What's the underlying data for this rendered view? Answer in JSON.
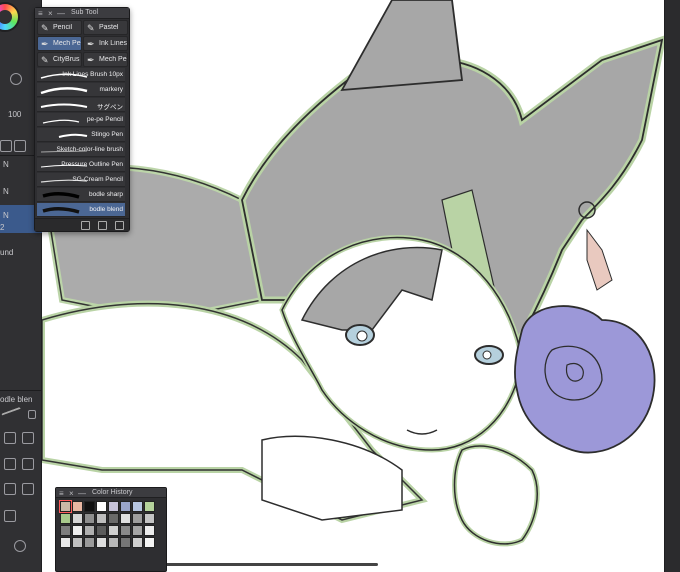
{
  "left_rail": {
    "zoom_value": "100",
    "layer_labels": [
      "N",
      "N",
      "N",
      "2"
    ],
    "layer_mode": "und",
    "brush_short": "odle blen"
  },
  "subtool": {
    "title": "Sub Tool",
    "tabs": [
      {
        "label": "Pencil",
        "icon": "pencil-icon"
      },
      {
        "label": "Pastel",
        "icon": "pastel-icon"
      },
      {
        "label": "Mech Pe",
        "icon": "mech-pen-icon"
      },
      {
        "label": "Ink Lines",
        "icon": "ink-pen-icon"
      },
      {
        "label": "CityBrus",
        "icon": "brush-icon"
      },
      {
        "label": "Mech Pe",
        "icon": "mech-pen-icon"
      }
    ],
    "active_tab": 2,
    "brushes": [
      "Ink Lines Brush 10px",
      "markery",
      "サグペン",
      "pe-pe Pencil",
      "Stingo Pen",
      "Sketch-color-line brush",
      "Pressure Outline Pen",
      "SG-Cream Pencil",
      "bodle sharp",
      "bodle blend"
    ],
    "active_brush": 9
  },
  "color_history": {
    "title": "Color History",
    "swatches": [
      "#c9b8a6",
      "#e9b7a3",
      "#111111",
      "#ffffff",
      "#c7c3d9",
      "#9aa5c9",
      "#b7c6e1",
      "#b5d39b",
      "#a8c98c",
      "#d6d6d6",
      "#8f8f8f",
      "#bdbdbd",
      "#6a6a6a",
      "#e0e0e0",
      "#9e9e9e",
      "#c4c4c4",
      "#7d7d7d",
      "#efefef",
      "#b0b0b0",
      "#5c5c5c",
      "#d0d0d0",
      "#8a8a8a",
      "#a5a5a5",
      "#ececec",
      "#e8e8e8",
      "#c0c0c0",
      "#9a9a9a",
      "#dedede",
      "#b8b8b8",
      "#767676",
      "#cfcfcf",
      "#f4f4f4"
    ]
  },
  "colors": {
    "accent": "#4b6794",
    "line_green": "#b9d3a5",
    "hair_gray": "#a7a7a7",
    "flower_purple": "#9c98d8",
    "eye_blue": "#b5d0dd"
  }
}
